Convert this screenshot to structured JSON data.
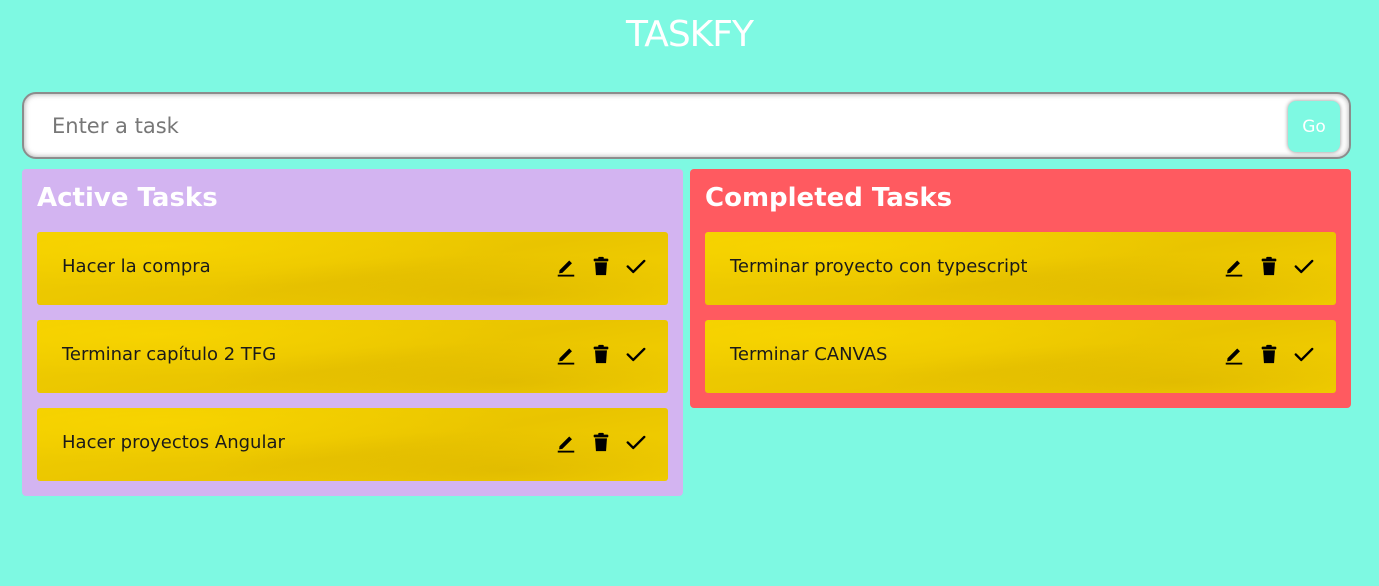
{
  "app": {
    "title": "TASKFY"
  },
  "form": {
    "placeholder": "Enter a task",
    "submit_label": "Go"
  },
  "active": {
    "title": "Active Tasks",
    "tasks": [
      {
        "text": "Hacer la compra"
      },
      {
        "text": "Terminar capítulo 2 TFG"
      },
      {
        "text": "Hacer proyectos Angular"
      }
    ]
  },
  "completed": {
    "title": "Completed Tasks",
    "tasks": [
      {
        "text": "Terminar proyecto con typescript"
      },
      {
        "text": "Terminar CANVAS"
      }
    ]
  },
  "icons": {
    "edit": "pencil-icon",
    "delete": "trash-icon",
    "complete": "check-icon"
  },
  "colors": {
    "background": "#7ef9e2",
    "active_panel": "#d3b4f1",
    "completed_panel": "#ff5a60",
    "task_card": "#f2cf00"
  }
}
